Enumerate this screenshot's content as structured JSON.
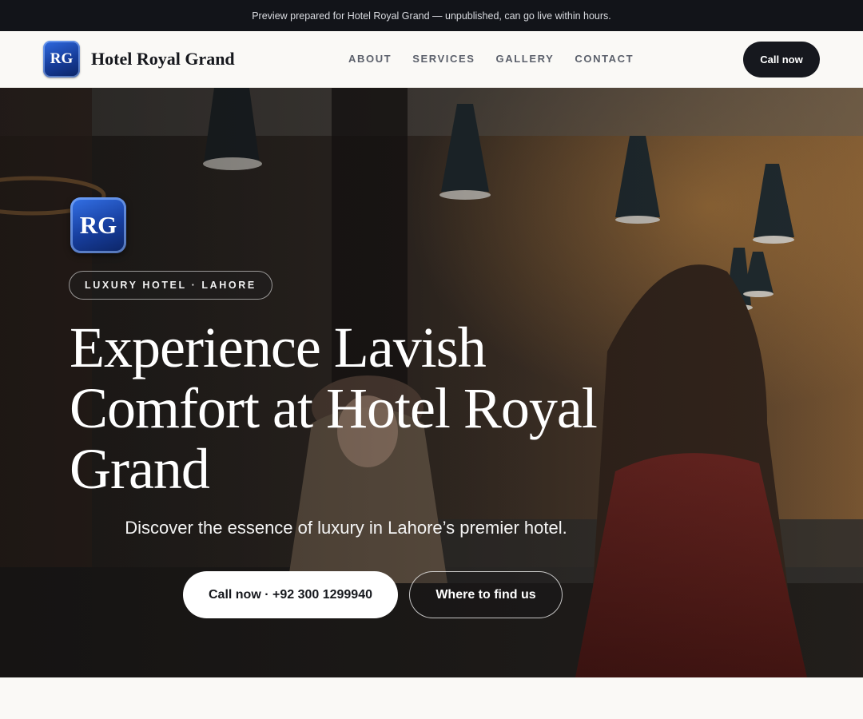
{
  "banner": {
    "text": "Preview prepared for Hotel Royal Grand — unpublished, can go live within hours."
  },
  "nav": {
    "logo_text": "RG",
    "brand_name": "Hotel Royal Grand",
    "links": [
      "ABOUT",
      "SERVICES",
      "GALLERY",
      "CONTACT"
    ],
    "call_label": "Call now"
  },
  "hero": {
    "logo_text": "RG",
    "eyebrow": "LUXURY HOTEL · LAHORE",
    "headline": "Experience Lavish Comfort at Hotel Royal Grand",
    "subtitle": "Discover the essence of luxury in Lahore’s premier hotel.",
    "call_button": "Call now · +92 300 1299940",
    "find_button": "Where to find us",
    "background_image": "hotel-reception-photo"
  },
  "colors": {
    "banner_bg": "#121419",
    "page_bg": "#faf9f6",
    "dark_button": "#16181e",
    "logo_blue": "#173e9e"
  }
}
